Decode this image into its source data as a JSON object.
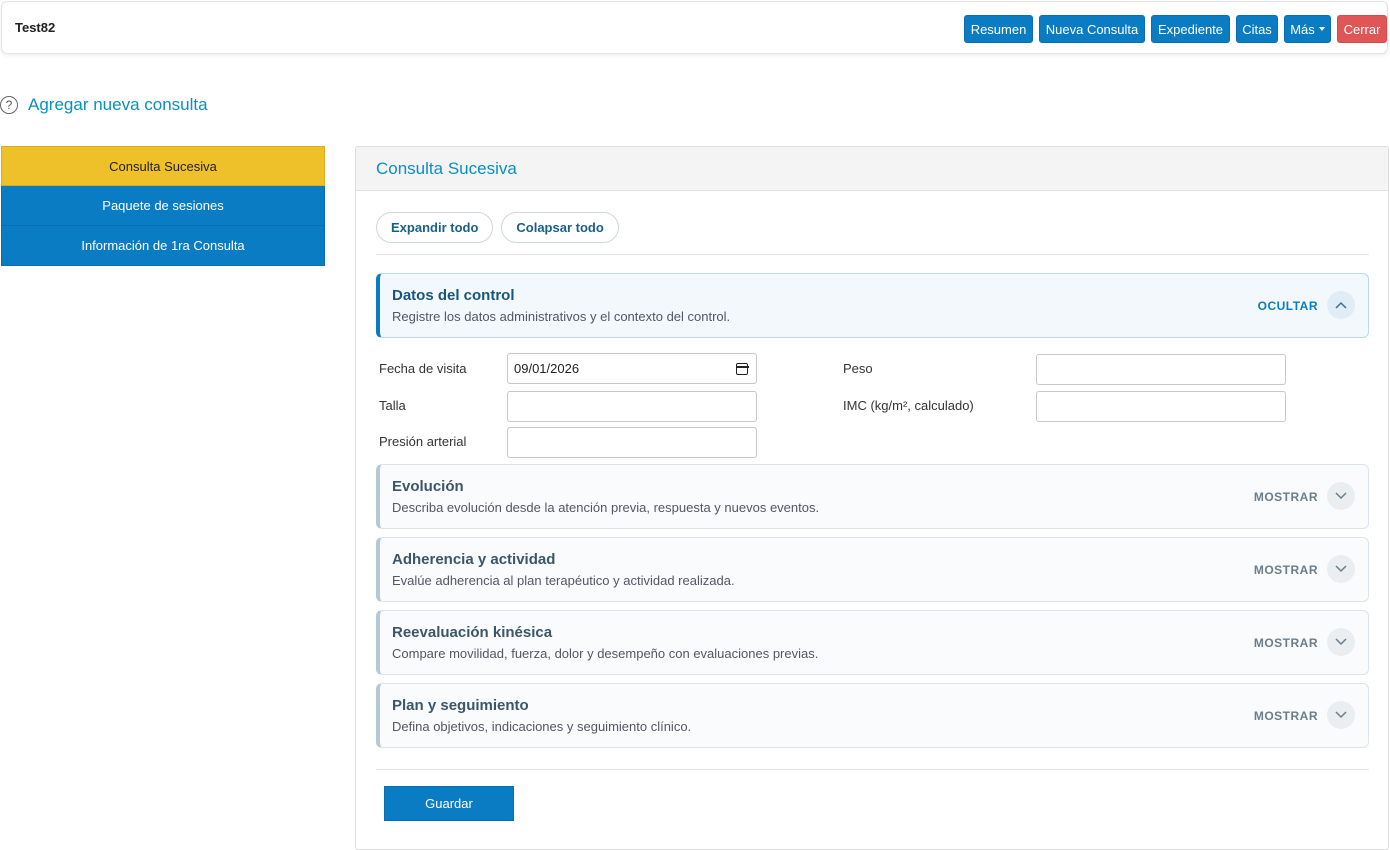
{
  "topbar": {
    "patient_name": "Test82",
    "buttons": {
      "resumen": "Resumen",
      "nueva_consulta": "Nueva Consulta",
      "expediente": "Expediente",
      "citas": "Citas",
      "mas": "Más",
      "cerrar": "Cerrar"
    }
  },
  "page": {
    "help_icon": "?",
    "title": "Agregar nueva consulta"
  },
  "sidebar": {
    "items": [
      {
        "label": "Consulta Sucesiva",
        "active": true
      },
      {
        "label": "Paquete de sesiones",
        "active": false
      },
      {
        "label": "Información de 1ra Consulta",
        "active": false
      }
    ]
  },
  "panel": {
    "title": "Consulta Sucesiva",
    "expand_all": "Expandir todo",
    "collapse_all": "Colapsar todo",
    "sections": [
      {
        "title": "Datos del control",
        "desc": "Registre los datos administrativos y el contexto del control.",
        "toggle": "OCULTAR",
        "open": true
      },
      {
        "title": "Evolución",
        "desc": "Describa evolución desde la atención previa, respuesta y nuevos eventos.",
        "toggle": "MOSTRAR",
        "open": false
      },
      {
        "title": "Adherencia y actividad",
        "desc": "Evalúe adherencia al plan terapéutico y actividad realizada.",
        "toggle": "MOSTRAR",
        "open": false
      },
      {
        "title": "Reevaluación kinésica",
        "desc": "Compare movilidad, fuerza, dolor y desempeño con evaluaciones previas.",
        "toggle": "MOSTRAR",
        "open": false
      },
      {
        "title": "Plan y seguimiento",
        "desc": "Defina objetivos, indicaciones y seguimiento clínico.",
        "toggle": "MOSTRAR",
        "open": false
      }
    ],
    "form": {
      "fecha_label": "Fecha de visita",
      "fecha_value": "09/01/2026",
      "peso_label": "Peso",
      "peso_value": "",
      "talla_label": "Talla",
      "talla_value": "",
      "imc_label": "IMC (kg/m², calculado)",
      "imc_value": "",
      "presion_label": "Presión arterial",
      "presion_value": ""
    },
    "save": "Guardar"
  },
  "colors": {
    "primary": "#0a7cc3",
    "danger": "#e05656",
    "active_tab": "#eec12a",
    "title": "#0a8fc2"
  }
}
